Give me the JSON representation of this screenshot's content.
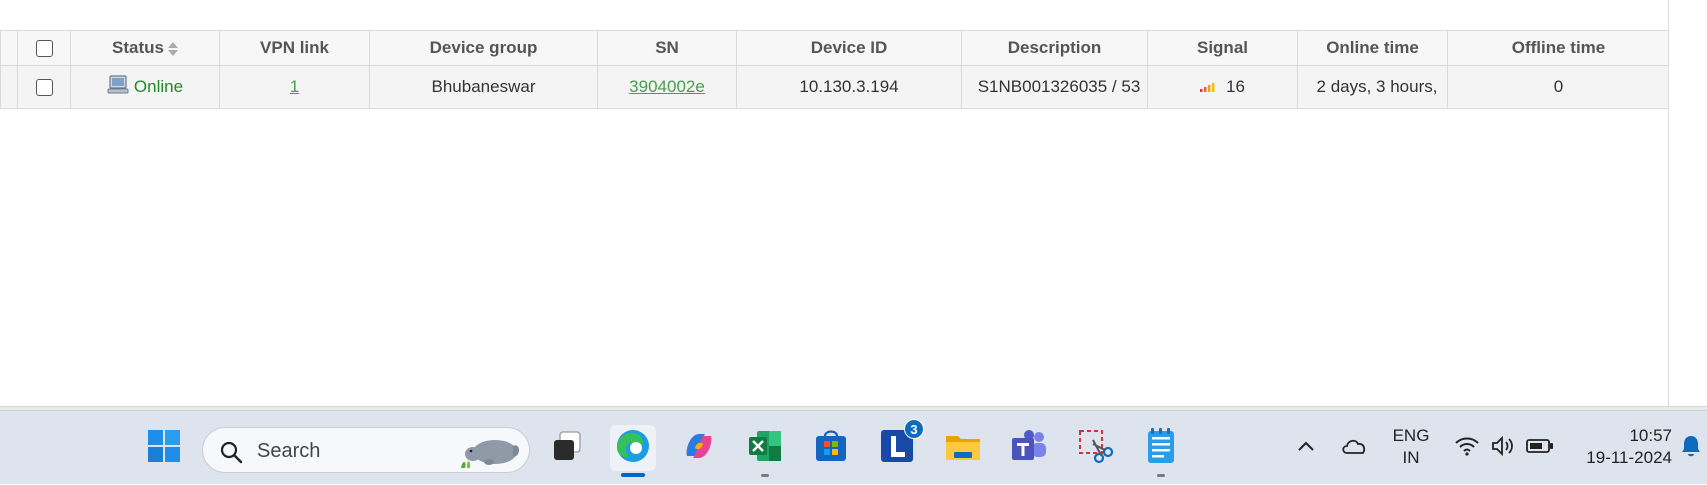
{
  "table": {
    "headers": [
      "Status",
      "VPN link",
      "Device group",
      "SN",
      "Device ID",
      "Description",
      "Signal",
      "Online time",
      "Offline time"
    ],
    "rows": [
      {
        "status": "Online",
        "vpn_link": "1",
        "device_group": "Bhubaneswar",
        "sn": "3904002e",
        "device_id": "10.130.3.194",
        "description": "S1NB001326035 / 53",
        "signal": "16",
        "online_time": "2 days, 3 hours,",
        "offline_time": "0"
      }
    ]
  },
  "taskbar": {
    "search_placeholder": "Search",
    "apps": [
      "windows-start",
      "task-view",
      "edge",
      "copilot",
      "excel",
      "microsoft-store",
      "l-app",
      "file-explorer",
      "teams",
      "snipping-tool",
      "notepad"
    ],
    "l_app_badge": "3",
    "language": {
      "line1": "ENG",
      "line2": "IN"
    },
    "time": "10:57",
    "date": "19-11-2024"
  },
  "colors": {
    "online_green": "#218a21",
    "link_green": "#4a9d4a",
    "accent_blue": "#0067c0"
  }
}
